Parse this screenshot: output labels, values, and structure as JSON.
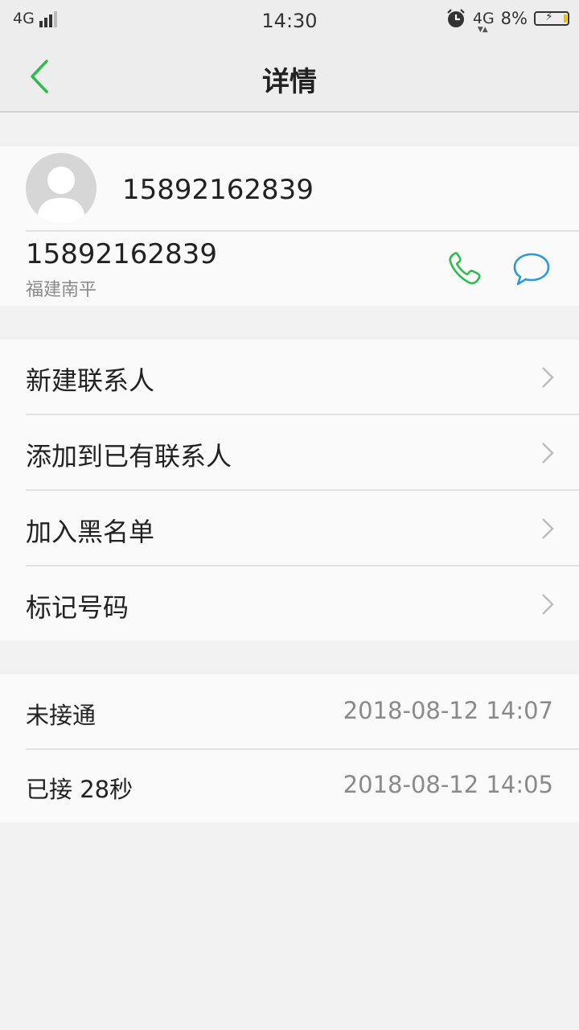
{
  "status_bar": {
    "network_left": "4G",
    "time": "14:30",
    "network_right": "4G",
    "battery": "8%"
  },
  "header": {
    "title": "详情",
    "back_icon": "chevron-left-icon"
  },
  "contact": {
    "name": "15892162839",
    "avatar_icon": "default-avatar-icon",
    "phone": "15892162839",
    "location": "福建南平"
  },
  "actions": [
    {
      "label": "新建联系人"
    },
    {
      "label": "添加到已有联系人"
    },
    {
      "label": "加入黑名单"
    },
    {
      "label": "标记号码"
    }
  ],
  "call_log": [
    {
      "status": "未接通",
      "time": "2018-08-12 14:07"
    },
    {
      "status": "已接 28秒",
      "time": "2018-08-12 14:05"
    }
  ],
  "colors": {
    "accent_green": "#2dbd4e",
    "message_blue": "#2a9bd8",
    "background": "#f2f2f2",
    "card": "#fafafa"
  }
}
